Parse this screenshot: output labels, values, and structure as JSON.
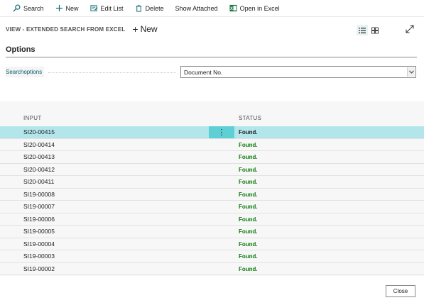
{
  "toolbar": {
    "search": {
      "label": "Search",
      "icon": "search-icon"
    },
    "new": {
      "label": "New",
      "icon": "plus-icon"
    },
    "edit_list": {
      "label": "Edit List",
      "icon": "edit-list-icon"
    },
    "delete": {
      "label": "Delete",
      "icon": "trash-icon"
    },
    "show_attached": {
      "label": "Show Attached"
    },
    "open_in_excel": {
      "label": "Open in Excel",
      "icon": "excel-icon"
    }
  },
  "page": {
    "title": "VIEW - EXTENDED SEARCH FROM EXCEL",
    "new_label": "New",
    "new_plus": "+"
  },
  "options": {
    "title": "Options",
    "searchoptions_label": "Searchoptions",
    "searchoptions_value": "Document No."
  },
  "table": {
    "columns": {
      "input": "INPUT",
      "status": "STATUS"
    },
    "rows": [
      {
        "input": "SI20-00415",
        "status": "Found."
      },
      {
        "input": "SI20-00414",
        "status": "Found."
      },
      {
        "input": "SI20-00413",
        "status": "Found."
      },
      {
        "input": "SI20-00412",
        "status": "Found."
      },
      {
        "input": "SI20-00411",
        "status": "Found."
      },
      {
        "input": "SI19-00008",
        "status": "Found."
      },
      {
        "input": "SI19-00007",
        "status": "Found."
      },
      {
        "input": "SI19-00006",
        "status": "Found."
      },
      {
        "input": "SI19-00005",
        "status": "Found."
      },
      {
        "input": "SI19-00004",
        "status": "Found."
      },
      {
        "input": "SI19-00003",
        "status": "Found."
      },
      {
        "input": "SI19-00002",
        "status": "Found."
      }
    ],
    "row_menu_glyph": "⋮"
  },
  "footer": {
    "close_label": "Close"
  },
  "colors": {
    "accent": "#00606b",
    "selected_row": "#b3e6eb",
    "row_menu": "#5fcfd6",
    "status_found": "#107c10",
    "excel_green": "#217346"
  }
}
